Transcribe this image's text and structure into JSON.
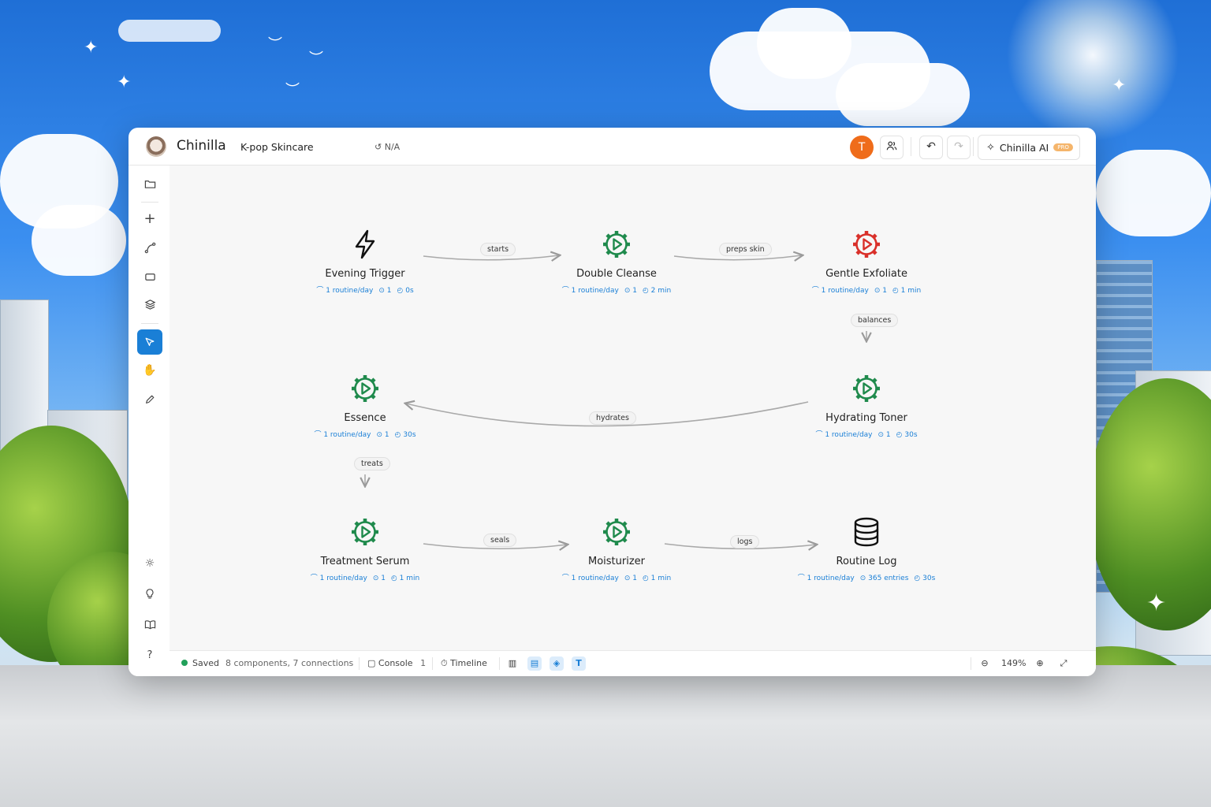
{
  "app": {
    "name": "Chinilla",
    "project": "K-pop Skincare",
    "version": "N/A",
    "avatar_initial": "T",
    "ai_label": "Chinilla AI",
    "ai_badge": "PRO"
  },
  "colors": {
    "accent": "#1a7fd6",
    "avatar": "#ef6c1a",
    "process_icon": "#1f8a4c",
    "warning_icon": "#d9302a",
    "saved": "#22a05a"
  },
  "sidebar": {
    "items": [
      {
        "name": "open-folder",
        "icon": "folder-icon"
      },
      {
        "name": "add",
        "icon": "plus-icon"
      },
      {
        "name": "connect",
        "icon": "connector-icon"
      },
      {
        "name": "container",
        "icon": "rectangle-icon"
      },
      {
        "name": "layers",
        "icon": "layers-icon"
      },
      {
        "name": "select",
        "icon": "cursor-icon",
        "active": true
      },
      {
        "name": "pan",
        "icon": "hand-icon"
      },
      {
        "name": "draw",
        "icon": "pencil-icon"
      },
      {
        "name": "theme",
        "icon": "sun-icon"
      },
      {
        "name": "tips",
        "icon": "lightbulb-icon"
      },
      {
        "name": "docs",
        "icon": "book-icon"
      },
      {
        "name": "help",
        "icon": "help-icon"
      }
    ]
  },
  "nodes": [
    {
      "id": "evening-trigger",
      "title": "Evening Trigger",
      "icon": "lightning-icon",
      "rate": "1 routine/day",
      "count": "1",
      "time": "0s"
    },
    {
      "id": "double-cleanse",
      "title": "Double Cleanse",
      "icon": "gear-play-icon",
      "rate": "1 routine/day",
      "count": "1",
      "time": "2 min"
    },
    {
      "id": "gentle-exfoliate",
      "title": "Gentle Exfoliate",
      "icon": "gear-play-icon",
      "status": "warning",
      "rate": "1 routine/day",
      "count": "1",
      "time": "1 min"
    },
    {
      "id": "essence",
      "title": "Essence",
      "icon": "gear-play-icon",
      "rate": "1 routine/day",
      "count": "1",
      "time": "30s"
    },
    {
      "id": "hydrating-toner",
      "title": "Hydrating Toner",
      "icon": "gear-play-icon",
      "rate": "1 routine/day",
      "count": "1",
      "time": "30s"
    },
    {
      "id": "treatment-serum",
      "title": "Treatment Serum",
      "icon": "gear-play-icon",
      "rate": "1 routine/day",
      "count": "1",
      "time": "1 min"
    },
    {
      "id": "moisturizer",
      "title": "Moisturizer",
      "icon": "gear-play-icon",
      "rate": "1 routine/day",
      "count": "1",
      "time": "1 min"
    },
    {
      "id": "routine-log",
      "title": "Routine Log",
      "icon": "database-icon",
      "rate": "1 routine/day",
      "count": "365 entries",
      "time": "30s"
    }
  ],
  "edges": [
    {
      "from": "evening-trigger",
      "to": "double-cleanse",
      "label": "starts"
    },
    {
      "from": "double-cleanse",
      "to": "gentle-exfoliate",
      "label": "preps skin"
    },
    {
      "from": "gentle-exfoliate",
      "to": "hydrating-toner",
      "label": "balances"
    },
    {
      "from": "hydrating-toner",
      "to": "essence",
      "label": "hydrates"
    },
    {
      "from": "essence",
      "to": "treatment-serum",
      "label": "treats"
    },
    {
      "from": "treatment-serum",
      "to": "moisturizer",
      "label": "seals"
    },
    {
      "from": "moisturizer",
      "to": "routine-log",
      "label": "logs"
    }
  ],
  "status": {
    "saved": "Saved",
    "summary": "8 components, 7 connections",
    "console_label": "Console",
    "console_count": "1",
    "timeline_label": "Timeline",
    "zoom": "149%"
  }
}
